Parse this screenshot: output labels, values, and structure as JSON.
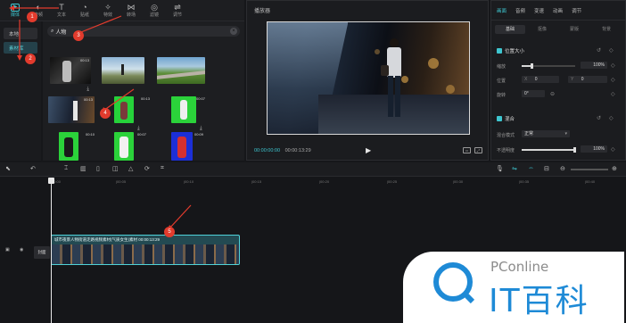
{
  "toolbar": {
    "tools": [
      {
        "label": "媒体",
        "icon": "media-icon"
      },
      {
        "label": "音频",
        "icon": "audio-icon"
      },
      {
        "label": "文本",
        "icon": "text-icon"
      },
      {
        "label": "贴纸",
        "icon": "sticker-icon"
      },
      {
        "label": "特效",
        "icon": "effects-icon"
      },
      {
        "label": "转场",
        "icon": "transition-icon"
      },
      {
        "label": "滤镜",
        "icon": "filter-icon"
      },
      {
        "label": "调节",
        "icon": "adjust-icon"
      }
    ]
  },
  "leftnav": {
    "local": "本地",
    "library": "素材库"
  },
  "search": {
    "value": "人物"
  },
  "thumbs": [
    {
      "dur": "00:13"
    },
    {
      "dur": ""
    },
    {
      "dur": ""
    },
    {
      "dur": "00:13"
    },
    {
      "dur": "00:13"
    },
    {
      "dur": "00:07"
    },
    {
      "dur": "00:10"
    },
    {
      "dur": "00:07"
    },
    {
      "dur": "00:09"
    }
  ],
  "player": {
    "title": "播放器",
    "current": "00:00:00:00",
    "total": "00:00:13:29"
  },
  "props": {
    "tabs": [
      "画面",
      "音频",
      "变速",
      "动画",
      "调节"
    ],
    "subtabs": [
      "基础",
      "抠像",
      "蒙版",
      "背景"
    ],
    "position_size": "位置大小",
    "scale_label": "缩放",
    "scale_value": "100%",
    "pos_label": "位置",
    "pos_x": "0",
    "pos_y": "0",
    "rot_label": "旋转",
    "rot_value": "0°",
    "blend": "混合",
    "blend_mode_label": "混合模式",
    "blend_mode_value": "正常",
    "opacity_label": "不透明度",
    "opacity_value": "100%",
    "scale_fraction": 0.2,
    "opacity_fraction": 1.0
  },
  "timeline": {
    "ruler": [
      "00:00",
      "|00:05",
      "|00:10",
      "|00:15",
      "|00:20",
      "|00:25",
      "|00:30",
      "|00:35",
      "|00:40"
    ],
    "cover_label": "封面",
    "clip_label": "城市夜景人物街道走路视频素材(气质女生)素材  00:00:13:29"
  },
  "annotations": [
    "1",
    "2",
    "3",
    "4",
    "5"
  ],
  "watermark": {
    "brand": "PConline",
    "name": "IT百科"
  },
  "colors": {
    "accent": "#3ec6d0",
    "annotation": "#e23b2d",
    "watermark": "#1e8ad6"
  }
}
